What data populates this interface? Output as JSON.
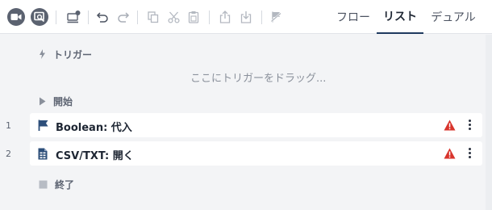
{
  "toolbar": {
    "icons": [
      "record-icon",
      "screen-record-icon",
      "run-from-here-icon",
      "undo-icon",
      "redo-icon",
      "copy-icon",
      "cut-icon",
      "paste-icon",
      "export-icon",
      "import-icon",
      "disable-icon"
    ]
  },
  "tabs": [
    {
      "label": "フロー",
      "active": false
    },
    {
      "label": "リスト",
      "active": true
    },
    {
      "label": "デュアル",
      "active": false
    }
  ],
  "flow": {
    "trigger_label": "トリガー",
    "drop_hint": "ここにトリガーをドラッグ...",
    "start_label": "開始",
    "end_label": "終了",
    "steps": [
      {
        "number": "1",
        "icon": "flag-icon",
        "label": "Boolean: 代入",
        "warning": true
      },
      {
        "number": "2",
        "icon": "document-icon",
        "label": "CSV/TXT: 開く",
        "warning": true
      }
    ]
  },
  "colors": {
    "warning": "#d8342c",
    "flag": "#2d4f7a",
    "active_tab_underline": "#1f3a5f"
  }
}
